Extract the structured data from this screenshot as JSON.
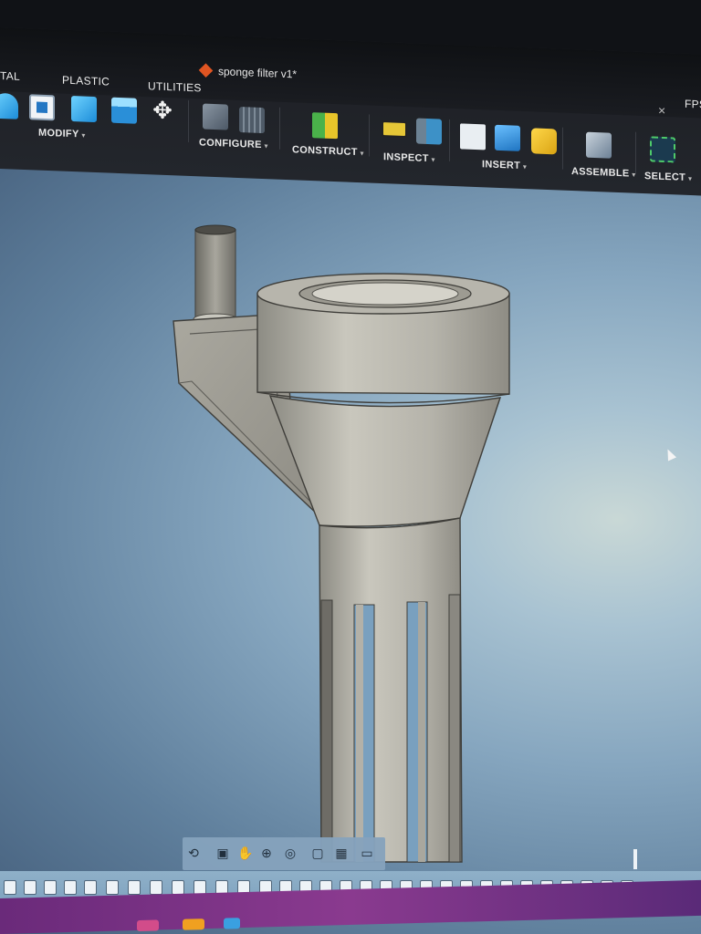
{
  "window": {
    "title": "sponge filter v1*",
    "close_glyph": "×",
    "fps_label": "FPS"
  },
  "tabs": {
    "left_cut": "TAL",
    "plastic": "PLASTIC",
    "utilities": "UTILITIES"
  },
  "groups": {
    "modify": "MODIFY",
    "configure": "CONFIGURE",
    "construct": "CONSTRUCT",
    "inspect": "INSPECT",
    "insert": "INSERT",
    "assemble": "ASSEMBLE",
    "select": "SELECT"
  },
  "dropdown_caret": "▾",
  "icons": {
    "modify_tools": [
      "fillet-icon",
      "shell-icon",
      "combine-icon",
      "press-pull-icon",
      "move-icon"
    ],
    "configure_tools": [
      "configure-table-icon",
      "configure-grid-icon"
    ],
    "construct_tools": [
      "offset-plane-icon"
    ],
    "inspect_tools": [
      "measure-icon",
      "section-analysis-icon"
    ],
    "insert_tools": [
      "insert-derive-icon",
      "insert-canvas-icon",
      "insert-mesh-icon"
    ],
    "assemble_tools": [
      "new-component-icon"
    ],
    "select_tools": [
      "select-box-icon"
    ]
  },
  "colors": {
    "viewport_accent": "#86a6bf",
    "model_grey": "#b9b7ad",
    "toolbar_bg": "#1d1f24",
    "select_green": "#4ecb6a",
    "taskbar": "#7a3286"
  }
}
